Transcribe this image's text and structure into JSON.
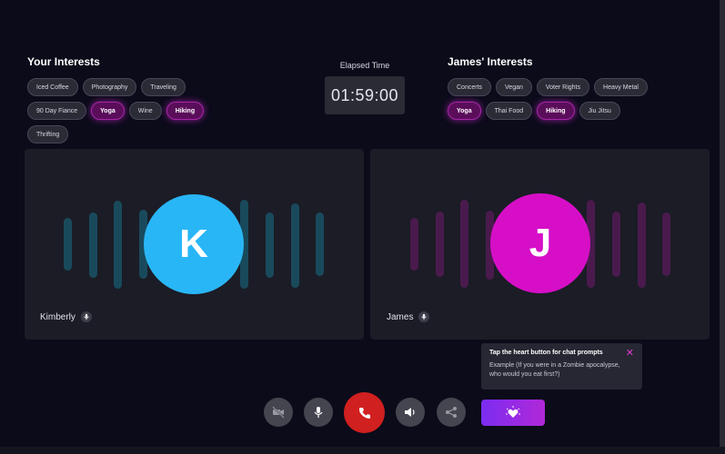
{
  "your_interests": {
    "title": "Your Interests",
    "chips": [
      {
        "label": "Iced Coffee",
        "active": false
      },
      {
        "label": "Photography",
        "active": false
      },
      {
        "label": "Traveling",
        "active": false
      },
      {
        "label": "90 Day Fiance",
        "active": false
      },
      {
        "label": "Yoga",
        "active": true
      },
      {
        "label": "Wine",
        "active": false
      },
      {
        "label": "Hiking",
        "active": true
      },
      {
        "label": "Thrifting",
        "active": false
      }
    ]
  },
  "james_interests": {
    "title": "James' Interests",
    "chips": [
      {
        "label": "Concerts",
        "active": false
      },
      {
        "label": "Vegan",
        "active": false
      },
      {
        "label": "Voter Rights",
        "active": false
      },
      {
        "label": "Heavy Metal",
        "active": false
      },
      {
        "label": "Yoga",
        "active": true
      },
      {
        "label": "Thai Food",
        "active": false
      },
      {
        "label": "Hiking",
        "active": true
      },
      {
        "label": "Jiu Jitsu",
        "active": false
      }
    ]
  },
  "timer": {
    "label": "Elapsed Time",
    "value": "01:59:00"
  },
  "participants": {
    "local": {
      "name": "Kimberly",
      "initial": "K",
      "avatar_color": "#29b6f6",
      "bar_color": "#194a5c"
    },
    "remote": {
      "name": "James",
      "initial": "J",
      "avatar_color": "#d60fc7",
      "bar_color": "#4a1a4d"
    }
  },
  "tooltip": {
    "title": "Tap the heart button for chat prompts",
    "body": "Example (If you were in a Zombie apocalypse, who would you eat first?)"
  },
  "controls": {
    "camera_off_icon": "video-off-icon",
    "mic_icon": "microphone-icon",
    "end_call_icon": "phone-icon",
    "speaker_icon": "speaker-icon",
    "share_icon": "share-icon",
    "prompt_icon": "heart-icon"
  }
}
